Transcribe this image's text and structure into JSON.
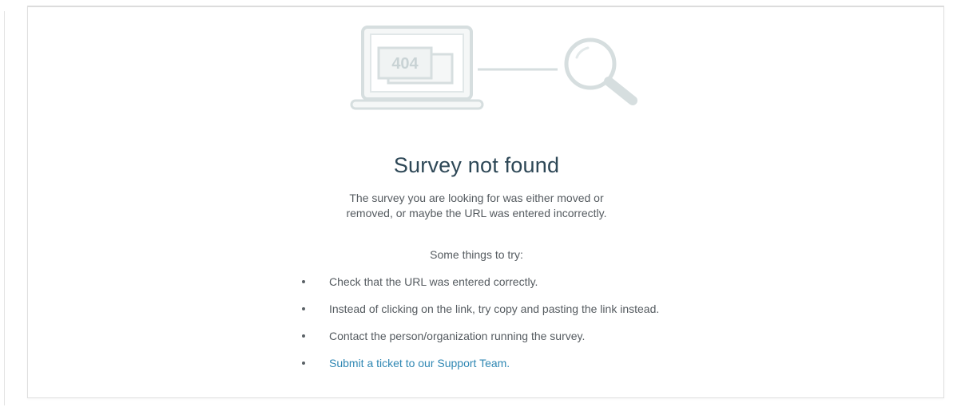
{
  "illustration": {
    "error_code": "404",
    "colors": {
      "stroke": "#d6dedf",
      "fill": "#f5f7f7",
      "text": "#c9d3d5"
    },
    "icons": [
      "laptop-icon",
      "magnifying-glass-icon"
    ]
  },
  "heading": "Survey not found",
  "description": {
    "line1": "The survey you are looking for was either moved or",
    "line2": "removed, or maybe the URL was entered incorrectly."
  },
  "tips_heading": "Some things to try:",
  "tips": [
    {
      "text": "Check that the URL was entered correctly."
    },
    {
      "text": "Instead of clicking on the link, try copy and pasting the link instead."
    },
    {
      "text": "Contact the person/organization running the survey."
    },
    {
      "text": "Submit a ticket to our Support Team."
    }
  ],
  "colors": {
    "heading": "#2d4756",
    "body_text": "#555b60",
    "link": "#2f87b3"
  }
}
